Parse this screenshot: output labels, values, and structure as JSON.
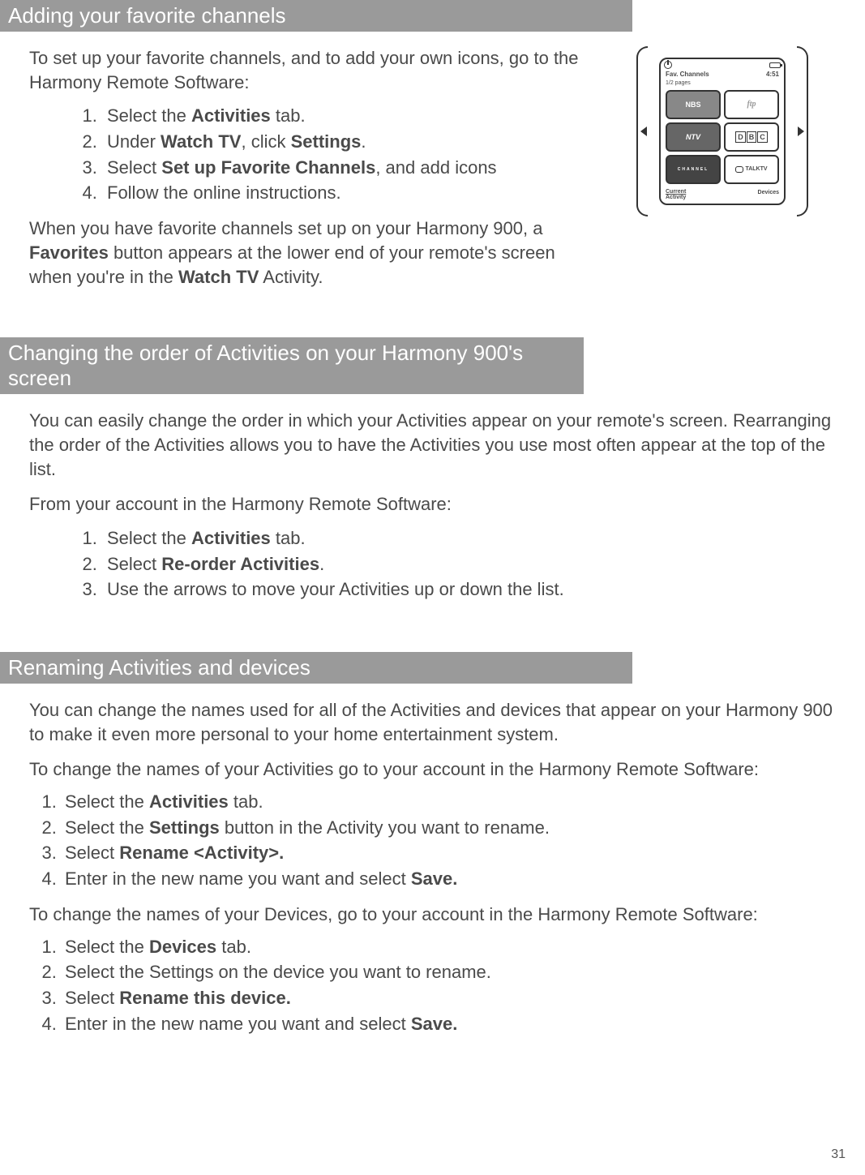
{
  "page_number": "31",
  "section1": {
    "heading": "Adding your favorite channels",
    "intro": "To set up your favorite channels, and to add your own icons, go to the Harmony Remote Software:",
    "steps": {
      "s1a": "Select the ",
      "s1b": "Activities",
      "s1c": " tab.",
      "s2a": "Under ",
      "s2b": "Watch TV",
      "s2c": ", click ",
      "s2d": "Settings",
      "s2e": ".",
      "s3a": "Select ",
      "s3b": "Set up Favorite Channels",
      "s3c": ", and add icons",
      "s4": "Follow the online instructions."
    },
    "outro_a": "When you have favorite channels set up on your Harmony 900, a ",
    "outro_b": "Favorites",
    "outro_c": " button appears at the lower end of your remote's screen when you're in the ",
    "outro_d": "Watch TV",
    "outro_e": " Activity."
  },
  "section2": {
    "heading": "Changing the order of Activities on your Harmony 900's screen",
    "intro": "You can easily change the order in which your Activities appear on your remote's screen.  Rearranging the order of the Activities allows you to have the Activities you use most often appear at the top of the list.",
    "lead": "From your account in the Harmony Remote Software:",
    "steps": {
      "s1a": "Select the ",
      "s1b": "Activities",
      "s1c": " tab.",
      "s2a": "Select ",
      "s2b": "Re-order Activities",
      "s2c": ".",
      "s3": "Use the arrows to move your Activities up or down the list."
    }
  },
  "section3": {
    "heading": "Renaming Activities and devices",
    "intro": "You can change the names used for all of the Activities and devices that appear on your Harmony 900 to make it even more personal to your home entertainment system.",
    "lead_activities": "To change the names of your Activities go to your account in the Harmony Remote Software:",
    "steps_a": {
      "s1a": "Select the ",
      "s1b": "Activities",
      "s1c": " tab.",
      "s2a": "Select the ",
      "s2b": "Settings",
      "s2c": " button in the Activity you want to rename.",
      "s3a": "Select ",
      "s3b": "Rename <Activity>.",
      "s4a": "Enter in the new name you want and select ",
      "s4b": "Save."
    },
    "lead_devices": "To change the names of your Devices, go to your account in the Harmony Remote Software:",
    "steps_d": {
      "s1a": "Select the ",
      "s1b": "Devices",
      "s1c": " tab.",
      "s2": "Select the Settings on the device you want to rename.",
      "s3a": "Select ",
      "s3b": "Rename this device.",
      "s4a": "Enter in the new name you want and select ",
      "s4b": "Save."
    }
  },
  "remote": {
    "title": "Fav. Channels",
    "pages": "1/2 pages",
    "time": "4:51",
    "nbs": "NBS",
    "ntv": "NTV",
    "dbc_d": "D",
    "dbc_b": "B",
    "dbc_c": "C",
    "channel": "CHANNEL",
    "talktv": "TALKTV",
    "script": "ftp",
    "bottom_left1": "Current",
    "bottom_left2": "Activity",
    "bottom_right": "Devices"
  }
}
